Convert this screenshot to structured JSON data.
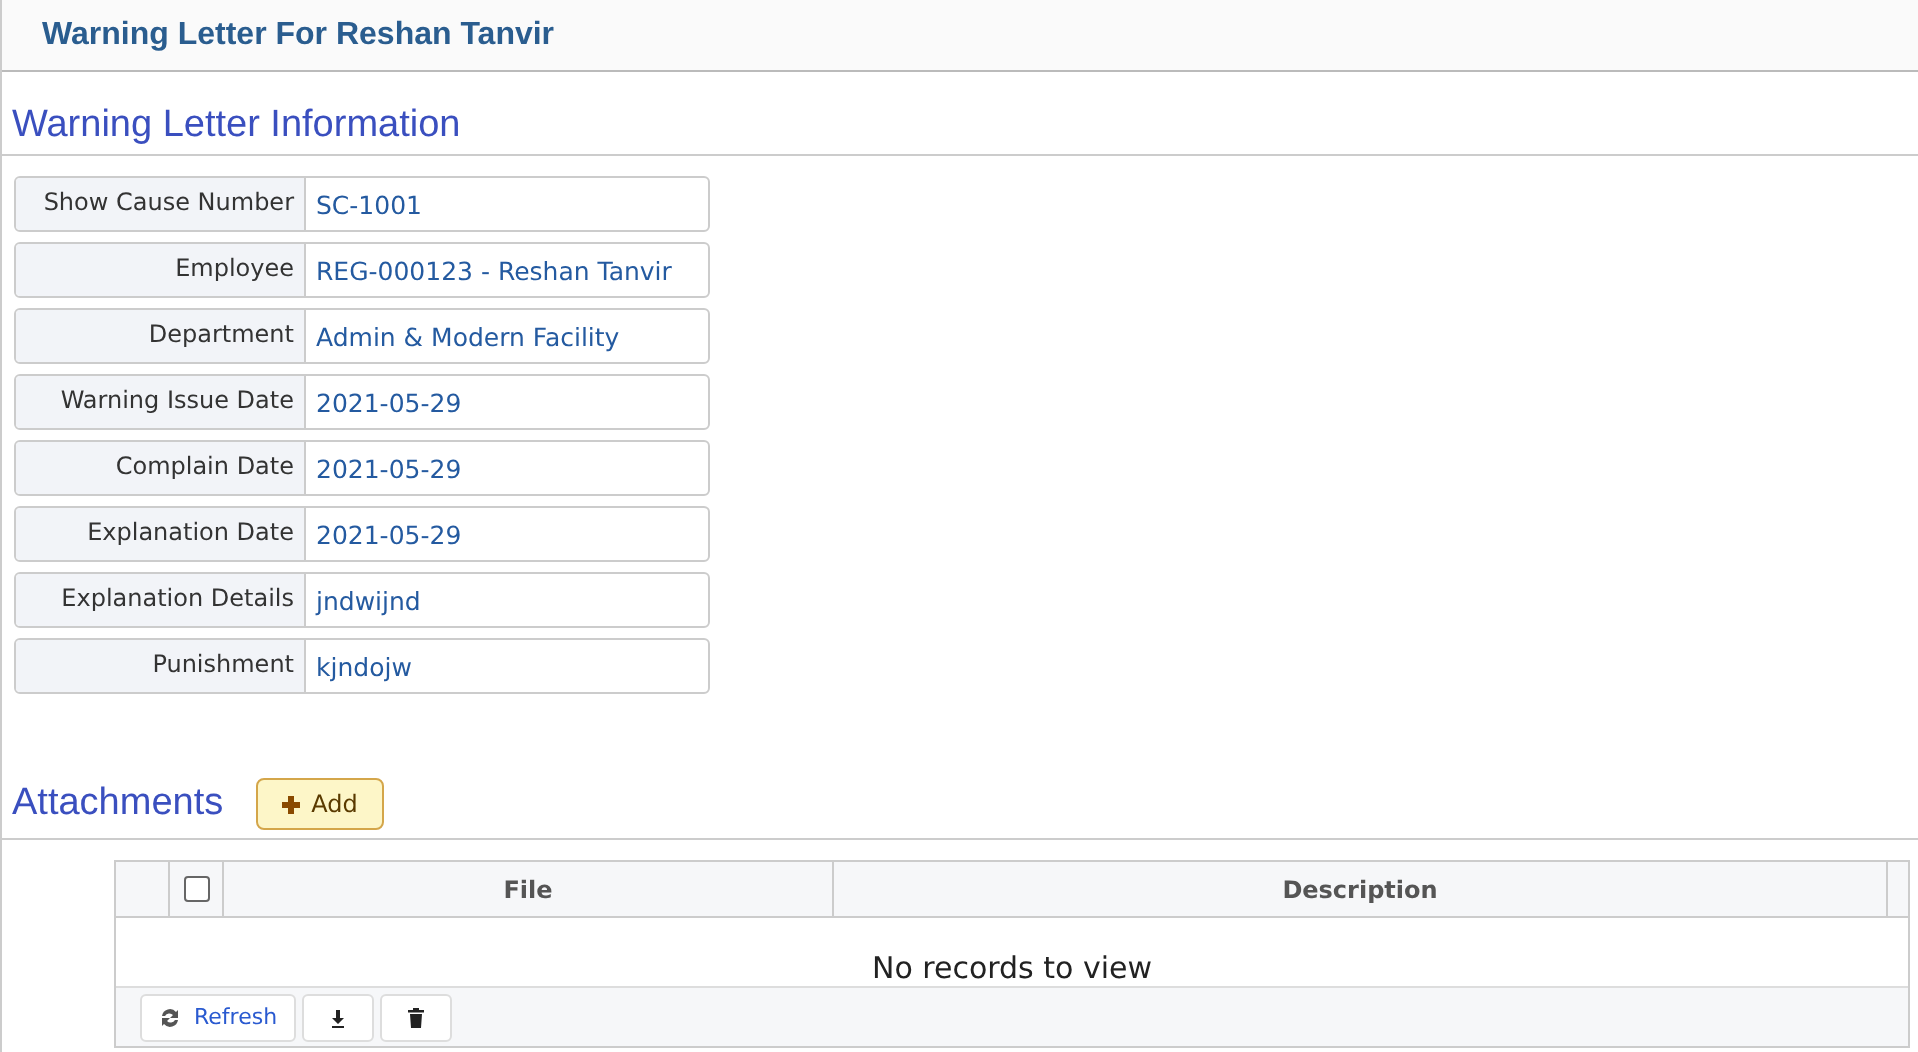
{
  "page_title": "Warning Letter For Reshan Tanvir",
  "section_title": "Warning Letter Information",
  "fields": [
    {
      "label": "Show Cause Number",
      "value": "SC-1001"
    },
    {
      "label": "Employee",
      "value": "REG-000123 - Reshan Tanvir"
    },
    {
      "label": "Department",
      "value": "Admin & Modern Facility"
    },
    {
      "label": "Warning Issue Date",
      "value": "2021-05-29"
    },
    {
      "label": "Complain Date",
      "value": "2021-05-29"
    },
    {
      "label": "Explanation Date",
      "value": "2021-05-29"
    },
    {
      "label": "Explanation Details",
      "value": "jndwijnd"
    },
    {
      "label": "Punishment",
      "value": "kjndojw"
    }
  ],
  "attachments": {
    "title": "Attachments",
    "add_button": "Add",
    "table": {
      "select_all_checked": false,
      "columns": [
        "File",
        "Description"
      ],
      "empty_message": "No records to view"
    },
    "pager_buttons": [
      {
        "kind": "refresh",
        "label": "Refresh"
      },
      {
        "kind": "download"
      },
      {
        "kind": "delete"
      }
    ]
  }
}
